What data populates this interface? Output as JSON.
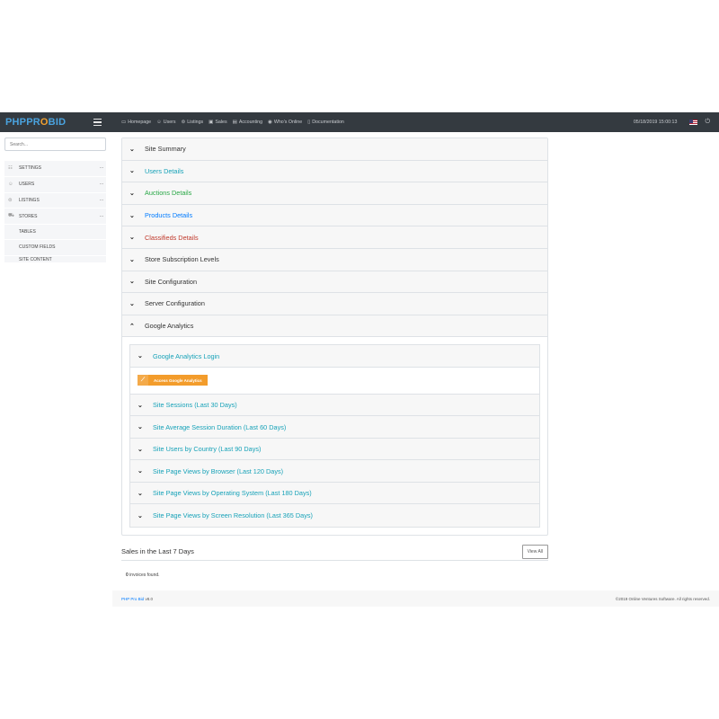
{
  "navbar": {
    "brand_pre": "PHP",
    "brand_o": "R",
    "brand_post": "BID",
    "brand_mid": "PR",
    "brand_oo": "O",
    "items": [
      {
        "icon": "monitor-icon",
        "label": "Homepage"
      },
      {
        "icon": "users-icon",
        "label": "Users"
      },
      {
        "icon": "listings-icon",
        "label": "Listings"
      },
      {
        "icon": "sales-icon",
        "label": "Sales"
      },
      {
        "icon": "accounting-icon",
        "label": "Accounting"
      },
      {
        "icon": "online-icon",
        "label": "Who's Online"
      },
      {
        "icon": "documentation-icon",
        "label": "Documentation"
      }
    ],
    "datetime": "05/18/2019 15:00:13"
  },
  "sidebar": {
    "search_placeholder": "Search...",
    "items": [
      {
        "label": "Settings",
        "icon": "settings-icon"
      },
      {
        "label": "Users",
        "icon": "users-icon"
      },
      {
        "label": "Listings",
        "icon": "listings-icon"
      },
      {
        "label": "Stores",
        "icon": "stores-icon"
      }
    ],
    "subitems": [
      "Tables",
      "Custom Fields",
      "Site Content"
    ],
    "dots": "···"
  },
  "accordion": [
    {
      "title": "Site Summary",
      "color": "dark"
    },
    {
      "title": "Users Details",
      "color": "info"
    },
    {
      "title": "Auctions Details",
      "color": "success"
    },
    {
      "title": "Products Details",
      "color": "primary"
    },
    {
      "title": "Classifieds Details",
      "color": "danger"
    },
    {
      "title": "Store Subscription Levels",
      "color": "dark"
    },
    {
      "title": "Site Configuration",
      "color": "dark"
    },
    {
      "title": "Server Configuration",
      "color": "dark"
    },
    {
      "title": "Google Analytics",
      "color": "dark"
    }
  ],
  "analytics": {
    "login_title": "Google Analytics Login",
    "access_button": "Access Google Analytics",
    "reports": [
      "Site Sessions (Last 30 Days)",
      "Site Average Session Duration (Last 60 Days)",
      "Site Users by Country (Last 90 Days)",
      "Site Page Views by Browser (Last 120 Days)",
      "Site Page Views by Operating System (Last 180 Days)",
      "Site Page Views by Screen Resolution (Last 365 Days)"
    ]
  },
  "sales": {
    "title": "Sales in the Last 7 Days",
    "view_all": "View All",
    "count": "0",
    "found_text": "invoices found."
  },
  "footer": {
    "product": "PHP Pro Bid",
    "version": "v8.0",
    "copyright": "©2019 Online Ventures Software. All rights reserved."
  },
  "colors": {
    "navbar_bg": "#343a40",
    "ga_button": "#f39c2b",
    "info": "#17a2b8",
    "success": "#28a745",
    "primary": "#007bff",
    "danger": "#c0392b"
  }
}
